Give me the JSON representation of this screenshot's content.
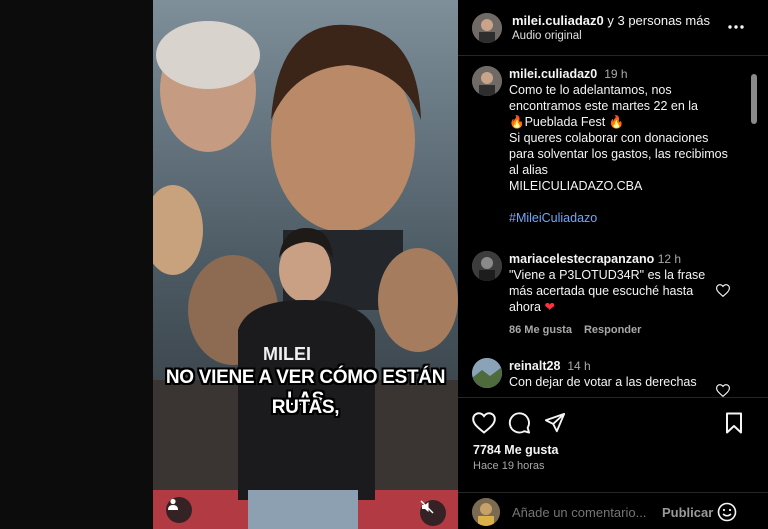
{
  "post": {
    "caption_line1": "NO VIENE A VER CÓMO ESTÁN LAS",
    "caption_line2": "RUTAS,"
  },
  "header": {
    "author": "milei.culiadaz0",
    "coauthors": " y 3 personas más",
    "audio": "Audio original"
  },
  "comments": [
    {
      "user": "milei.culiadaz0",
      "time": "19 h",
      "lines": [
        "Como te lo adelantamos, nos",
        "encontramos este martes 22 en la",
        "🔥Pueblada Fest 🔥",
        "Si queres colaborar con donaciones",
        "para solventar los gastos, las recibimos",
        "al alias",
        "MILEICULIADAZO.CBA"
      ],
      "hashtag": "#MileiCuliadazo"
    },
    {
      "user": "mariacelestecrapanzano",
      "time": "12 h",
      "lines": [
        "\"Viene a P3LOTUD34R\" es la frase",
        "más acertada que escuché hasta",
        "ahora"
      ],
      "likes": "86 Me gusta",
      "reply": "Responder"
    },
    {
      "user": "reinalt28",
      "time": "14 h",
      "lines": [
        "Con dejar de votar a las derechas"
      ]
    }
  ],
  "footer": {
    "likes": "7784 Me gusta",
    "time_ago": "Hace 19 horas",
    "add_comment_placeholder": "Añade un comentario...",
    "publish": "Publicar"
  },
  "colors": {
    "background": "#000000",
    "hashtag": "#6ea8ff",
    "heart": "#ff3040"
  },
  "icons": [
    "heart-icon",
    "comment-icon",
    "share-icon",
    "bookmark-icon",
    "more-options-icon",
    "emoji-icon",
    "mute-icon",
    "user-tag-icon"
  ]
}
